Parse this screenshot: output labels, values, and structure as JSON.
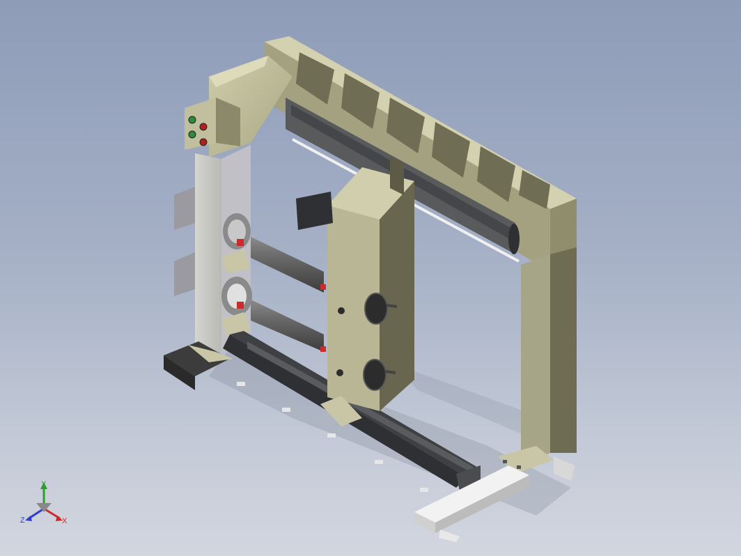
{
  "viewport": {
    "background_top": "#8e9cb8",
    "background_bottom": "#d2d6df"
  },
  "model": {
    "frame_color": "#b5b394",
    "frame_shadow_color": "#6e6c52",
    "roller_color": "#5d5d5d",
    "indicator_colors": [
      "#2e8b3a",
      "#b02020",
      "#2e8b3a",
      "#b02020"
    ]
  },
  "triad": {
    "x_label": "X",
    "y_label": "Y",
    "z_label": "Z",
    "x_color": "#cc2a2a",
    "y_color": "#2aa02a",
    "z_color": "#2a3fd0"
  }
}
